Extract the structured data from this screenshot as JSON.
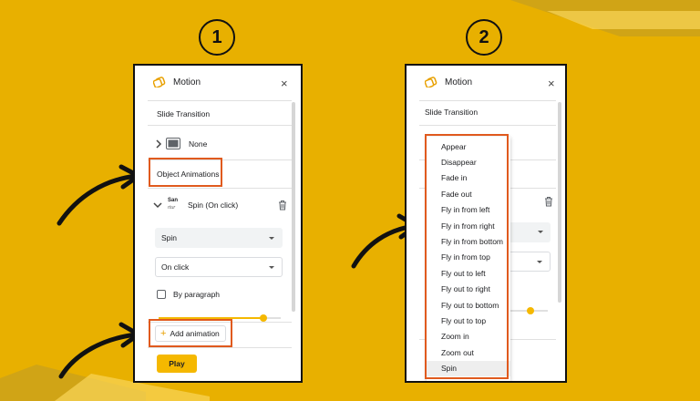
{
  "steps": [
    "1",
    "2"
  ],
  "colors": {
    "background": "#E8B000",
    "highlight": "#E05A1E",
    "accent": "#F5B800"
  },
  "panel1": {
    "icon": "motion-icon",
    "title": "Motion",
    "close": "×",
    "slide_transition_heading": "Slide Transition",
    "transition_value": "None",
    "object_animations_heading": "Object Animations",
    "animation_item_thumb": "San",
    "animation_item_thumb_sub": "rtur",
    "animation_item_label": "Spin  (On click)",
    "effect_select": "Spin",
    "trigger_select": "On click",
    "by_paragraph_label": "By paragraph",
    "add_animation_label": "Add animation",
    "play_label": "Play"
  },
  "panel2": {
    "icon": "motion-icon",
    "title": "Motion",
    "close": "×",
    "slide_transition_heading": "Slide Transition",
    "menu_items": [
      "Appear",
      "Disappear",
      "Fade in",
      "Fade out",
      "Fly in from left",
      "Fly in from right",
      "Fly in from bottom",
      "Fly in from top",
      "Fly out to left",
      "Fly out to right",
      "Fly out to bottom",
      "Fly out to top",
      "Zoom in",
      "Zoom out",
      "Spin"
    ],
    "selected_item": "Spin"
  }
}
